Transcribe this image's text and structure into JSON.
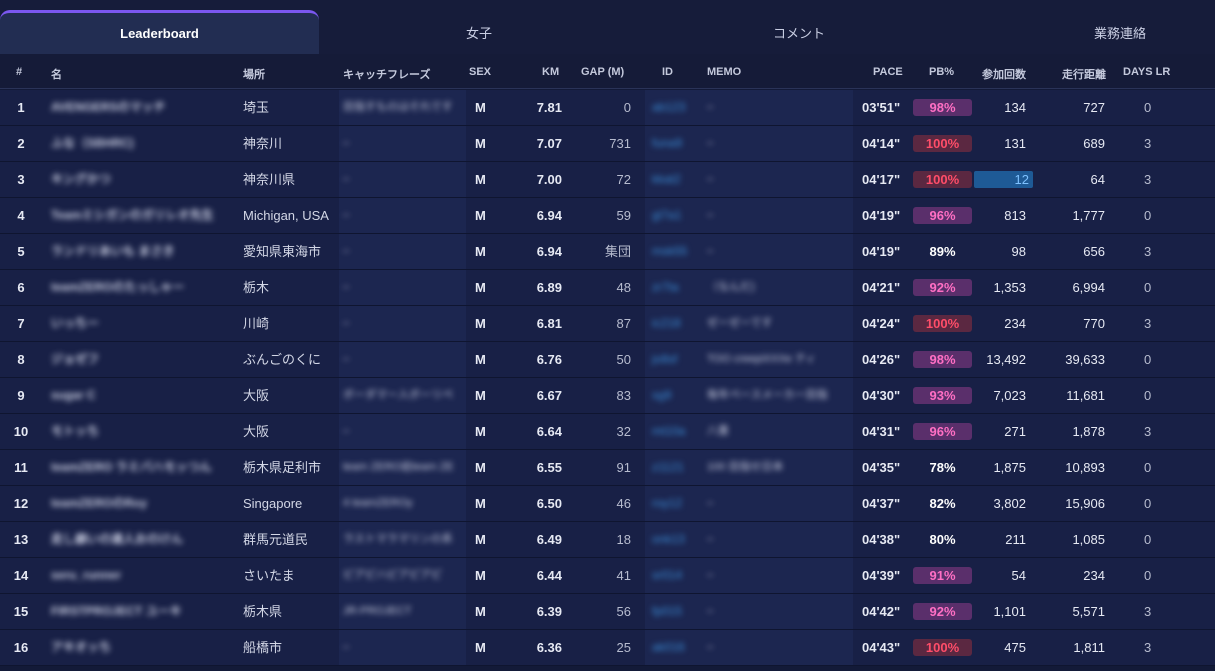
{
  "tabs": [
    {
      "label": "Leaderboard",
      "active": true
    },
    {
      "label": "女子",
      "active": false
    },
    {
      "label": "コメント",
      "active": false
    },
    {
      "label": "業務連絡",
      "active": false
    }
  ],
  "columns": {
    "rank": "#",
    "name": "名",
    "location": "場所",
    "catchphrase": "キャッチフレーズ",
    "sex": "SEX",
    "km": "KM",
    "gap": "GAP (M)",
    "id": "ID",
    "memo": "MEMO",
    "pace": "PACE",
    "pb": "PB%",
    "participations": "参加回数",
    "distance": "走行距離",
    "days_lr": "DAYS LR"
  },
  "colors": {
    "pb_pink": "#ff6fc4",
    "pb_red": "#ff4d69",
    "accent": "#7b57f0",
    "id_link": "#3b8ed8"
  },
  "rows": [
    {
      "rank": "1",
      "name": "AVENGERSのマッチ",
      "location": "埼玉",
      "catchphrase": "目指すものはそれです",
      "sex": "M",
      "km": "7.81",
      "gap": "0",
      "id": "ab123",
      "memo": "–",
      "pace": "03'51\"",
      "pb": "98%",
      "pb_style": "pink",
      "participations": "134",
      "distance": "727",
      "days_lr": "0",
      "hl": false
    },
    {
      "rank": "2",
      "name": "ふな（SBHRC)",
      "location": "神奈川",
      "catchphrase": "–",
      "sex": "M",
      "km": "7.07",
      "gap": "731",
      "id": "funa9",
      "memo": "–",
      "pace": "04'14\"",
      "pb": "100%",
      "pb_style": "red",
      "participations": "131",
      "distance": "689",
      "days_lr": "3",
      "hl": false
    },
    {
      "rank": "3",
      "name": "キングかつ",
      "location": "神奈川県",
      "catchphrase": "–",
      "sex": "M",
      "km": "7.00",
      "gap": "72",
      "id": "kkat2",
      "memo": "–",
      "pace": "04'17\"",
      "pb": "100%",
      "pb_style": "red",
      "participations": "12",
      "distance": "64",
      "days_lr": "3",
      "hl": true
    },
    {
      "rank": "4",
      "name": "Teamミシガンのガリレオ先生",
      "location": "Michigan, USA",
      "catchphrase": "–",
      "sex": "M",
      "km": "6.94",
      "gap": "59",
      "id": "gl7a1",
      "memo": "–",
      "pace": "04'19\"",
      "pb": "96%",
      "pb_style": "pink",
      "participations": "813",
      "distance": "1,777",
      "days_lr": "0",
      "hl": false
    },
    {
      "rank": "5",
      "name": "ランドリあいも まさき",
      "location": "愛知県東海市",
      "catchphrase": "–",
      "sex": "M",
      "km": "6.94",
      "gap": "集団",
      "id": "msk55",
      "memo": "–",
      "pace": "04'19\"",
      "pb": "89%",
      "pb_style": "none",
      "participations": "98",
      "distance": "656",
      "days_lr": "3",
      "hl": false
    },
    {
      "rank": "6",
      "name": "teamZEROのたっしゃー",
      "location": "栃木",
      "catchphrase": "–",
      "sex": "M",
      "km": "6.89",
      "gap": "48",
      "id": "zr7ta",
      "memo": "（なんだ)",
      "pace": "04'21\"",
      "pb": "92%",
      "pb_style": "pink",
      "participations": "1,353",
      "distance": "6,994",
      "days_lr": "0",
      "hl": false
    },
    {
      "rank": "7",
      "name": "いっちー",
      "location": "川崎",
      "catchphrase": "–",
      "sex": "M",
      "km": "6.81",
      "gap": "87",
      "id": "ic218",
      "memo": "ゼーゼーです",
      "pace": "04'24\"",
      "pb": "100%",
      "pb_style": "red",
      "participations": "234",
      "distance": "770",
      "days_lr": "3",
      "hl": false
    },
    {
      "rank": "8",
      "name": "ジョゼフ",
      "location": "ぶんごのくに",
      "catchphrase": "–",
      "sex": "M",
      "km": "6.76",
      "gap": "50",
      "id": "jo8sf",
      "memo": "TOO creepiXXXe ティ",
      "pace": "04'26\"",
      "pb": "98%",
      "pb_style": "pink",
      "participations": "13,492",
      "distance": "39,633",
      "days_lr": "0",
      "hl": false
    },
    {
      "rank": "9",
      "name": "sugar C",
      "location": "大阪",
      "catchphrase": "ボーダマー入ボーリペ",
      "sex": "M",
      "km": "6.67",
      "gap": "83",
      "id": "sg9",
      "memo": "毎年ペースメーカー目指",
      "pace": "04'30\"",
      "pb": "93%",
      "pb_style": "pink",
      "participations": "7,023",
      "distance": "11,681",
      "days_lr": "0",
      "hl": false
    },
    {
      "rank": "10",
      "name": "モトッち",
      "location": "大阪",
      "catchphrase": "–",
      "sex": "M",
      "km": "6.64",
      "gap": "32",
      "id": "mt10a",
      "memo": "八重",
      "pace": "04'31\"",
      "pb": "96%",
      "pb_style": "pink",
      "participations": "271",
      "distance": "1,878",
      "days_lr": "3",
      "hl": false
    },
    {
      "rank": "11",
      "name": "teamZERO ラミバハモッつん",
      "location": "栃木県足利市",
      "catchphrase": "team ZERO岩team ZE",
      "sex": "M",
      "km": "6.55",
      "gap": "91",
      "id": "z1121",
      "memo": "100 目指せ日本",
      "pace": "04'35\"",
      "pb": "78%",
      "pb_style": "none",
      "participations": "1,875",
      "distance": "10,893",
      "days_lr": "0",
      "hl": false
    },
    {
      "rank": "12",
      "name": "teamZEROのRoy",
      "location": "Singapore",
      "catchphrase": "4 teamZEROy",
      "sex": "M",
      "km": "6.50",
      "gap": "46",
      "id": "roy12",
      "memo": "–",
      "pace": "04'37\"",
      "pb": "82%",
      "pb_style": "none",
      "participations": "3,802",
      "distance": "15,906",
      "days_lr": "0",
      "hl": false
    },
    {
      "rank": "13",
      "name": "走し癖いの達人おのけん",
      "location": "群馬元道民",
      "catchphrase": "ラストマラマリンの系",
      "sex": "M",
      "km": "6.49",
      "gap": "18",
      "id": "onk13",
      "memo": "–",
      "pace": "04'38\"",
      "pb": "80%",
      "pb_style": "none",
      "participations": "211",
      "distance": "1,085",
      "days_lr": "0",
      "hl": false
    },
    {
      "rank": "14",
      "name": "seru_runner",
      "location": "さいたま",
      "catchphrase": "ピアピハピアピアピ",
      "sex": "M",
      "km": "6.44",
      "gap": "41",
      "id": "sr014",
      "memo": "–",
      "pace": "04'39\"",
      "pb": "91%",
      "pb_style": "pink",
      "participations": "54",
      "distance": "234",
      "days_lr": "0",
      "hl": false
    },
    {
      "rank": "15",
      "name": "FIRSTPROJECT ユーキ",
      "location": "栃木県",
      "catchphrase": "JR-PROJECT",
      "sex": "M",
      "km": "6.39",
      "gap": "56",
      "id": "fp015",
      "memo": "–",
      "pace": "04'42\"",
      "pb": "92%",
      "pb_style": "pink",
      "participations": "1,101",
      "distance": "5,571",
      "days_lr": "3",
      "hl": false
    },
    {
      "rank": "16",
      "name": "アキオッち",
      "location": "船橋市",
      "catchphrase": "–",
      "sex": "M",
      "km": "6.36",
      "gap": "25",
      "id": "ak016",
      "memo": "–",
      "pace": "04'43\"",
      "pb": "100%",
      "pb_style": "red",
      "participations": "475",
      "distance": "1,811",
      "days_lr": "3",
      "hl": false
    }
  ]
}
